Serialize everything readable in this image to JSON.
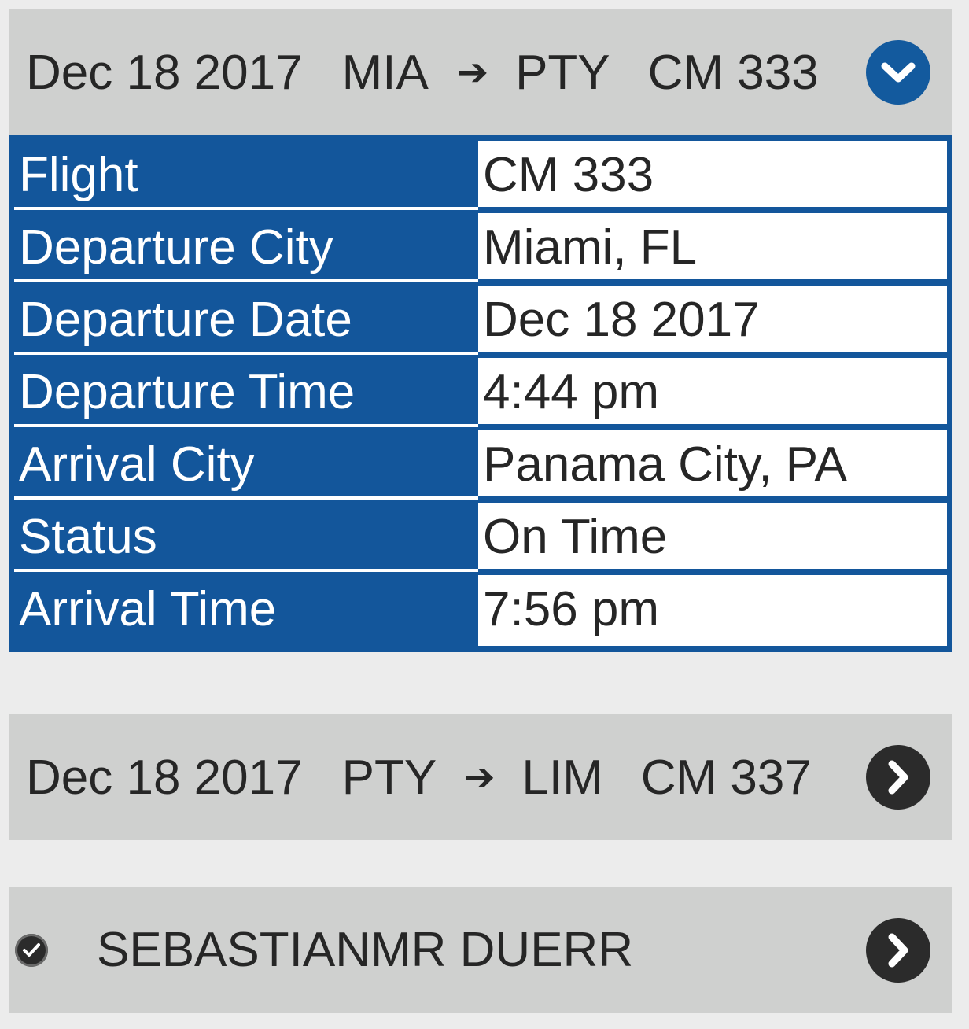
{
  "segments": [
    {
      "date": "Dec 18 2017",
      "from": "MIA",
      "arrow": "➔",
      "to": "PTY",
      "flight": "CM 333",
      "expanded": true,
      "toggle_icon": "chevron-down-icon",
      "accent": "#135a9e"
    },
    {
      "date": "Dec 18 2017",
      "from": "PTY",
      "arrow": "➔",
      "to": "LIM",
      "flight": "CM 337",
      "expanded": false,
      "toggle_icon": "chevron-right-icon",
      "accent": "#2b2b2b"
    }
  ],
  "details": {
    "rows": [
      {
        "label": "Flight",
        "value": "CM 333"
      },
      {
        "label": "Departure City",
        "value": "Miami, FL"
      },
      {
        "label": "Departure Date",
        "value": "Dec 18 2017"
      },
      {
        "label": "Departure Time",
        "value": "4:44 pm"
      },
      {
        "label": "Arrival City",
        "value": "Panama City, PA"
      },
      {
        "label": "Status",
        "value": "On Time"
      },
      {
        "label": "Arrival Time",
        "value": "7:56 pm"
      }
    ],
    "header_color": "#13569b"
  },
  "passenger": {
    "name": "SEBASTIANMR DUERR",
    "checked": true,
    "status_icon": "check-circle-icon",
    "toggle_icon": "chevron-right-icon"
  }
}
